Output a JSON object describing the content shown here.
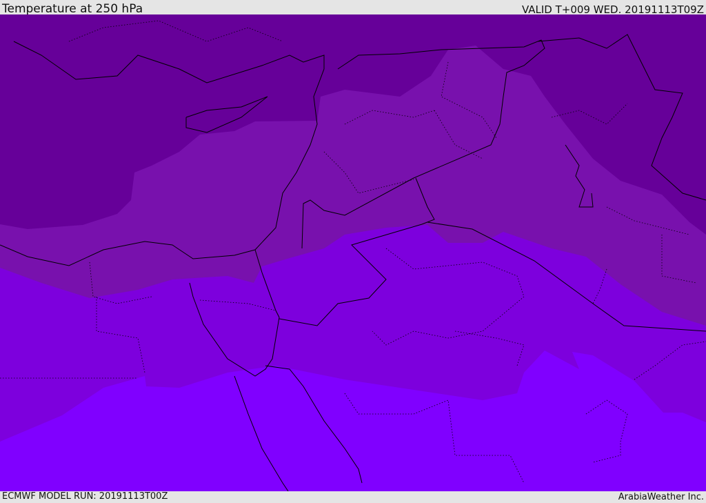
{
  "header": {
    "title": "Temperature at 250 hPa",
    "valid": "VALID T+009 WED. 20191113T09Z"
  },
  "footer": {
    "model_run": "ECMWF MODEL RUN: 20191113T00Z",
    "credit": "ArabiaWeather Inc."
  },
  "colors": {
    "band_coldest": "#660099",
    "band_cold": "#7811ad",
    "band_mid": "#7d00dd",
    "band_warm": "#8000ff",
    "coastline": "#000000"
  }
}
